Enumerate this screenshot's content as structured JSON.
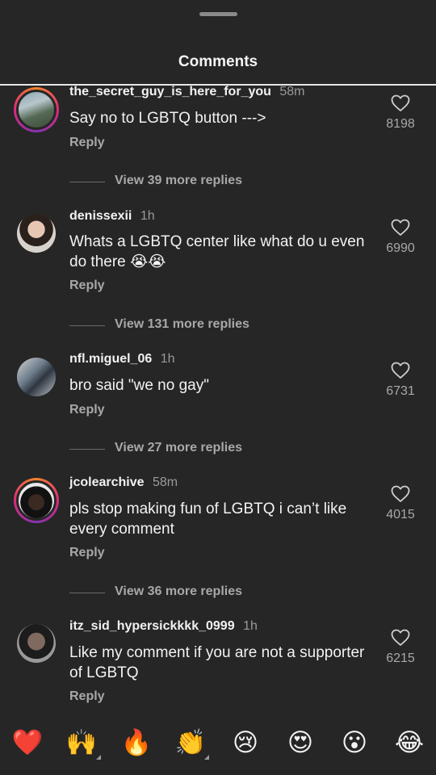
{
  "header": {
    "title": "Comments"
  },
  "comments": [
    {
      "username": "the_secret_guy_is_here_for_you",
      "time": "58m",
      "text": "Say no to LGBTQ button --->",
      "reply_label": "Reply",
      "likes": "8198",
      "more_replies": "View 39 more replies",
      "avatar_icon": "avatar-story-ring"
    },
    {
      "username": "denissexii",
      "time": "1h",
      "text": "Whats a LGBTQ center like what do u even do there 😭😭",
      "reply_label": "Reply",
      "likes": "6990",
      "more_replies": "View 131 more replies",
      "avatar_icon": "avatar"
    },
    {
      "username": "nfl.miguel_06",
      "time": "1h",
      "text": "bro said \"we no gay\"",
      "reply_label": "Reply",
      "likes": "6731",
      "more_replies": "View 27 more replies",
      "avatar_icon": "avatar"
    },
    {
      "username": "jcolearchive",
      "time": "58m",
      "text": "pls stop making fun of LGBTQ i can’t like every comment",
      "reply_label": "Reply",
      "likes": "4015",
      "more_replies": "View 36 more replies",
      "avatar_icon": "avatar-story-ring"
    },
    {
      "username": "itz_sid_hypersickkkk_0999",
      "time": "1h",
      "text": "Like my comment if you are not a supporter of LGBTQ",
      "reply_label": "Reply",
      "likes": "6215",
      "avatar_icon": "avatar"
    }
  ],
  "emoji_bar": [
    {
      "glyph": "❤️",
      "icon": "red-heart-icon"
    },
    {
      "glyph": "🙌",
      "icon": "raising-hands-icon"
    },
    {
      "glyph": "🔥",
      "icon": "fire-icon"
    },
    {
      "glyph": "👏",
      "icon": "clapping-hands-icon"
    },
    {
      "glyph": "😢",
      "icon": "crying-face-icon"
    },
    {
      "glyph": "😍",
      "icon": "heart-eyes-icon"
    },
    {
      "glyph": "😮",
      "icon": "surprised-face-icon"
    },
    {
      "glyph": "😂",
      "icon": "tears-of-joy-icon"
    }
  ],
  "colors": {
    "background": "#262626",
    "text": "#f2f2f2",
    "secondary": "#a8a8a8"
  }
}
